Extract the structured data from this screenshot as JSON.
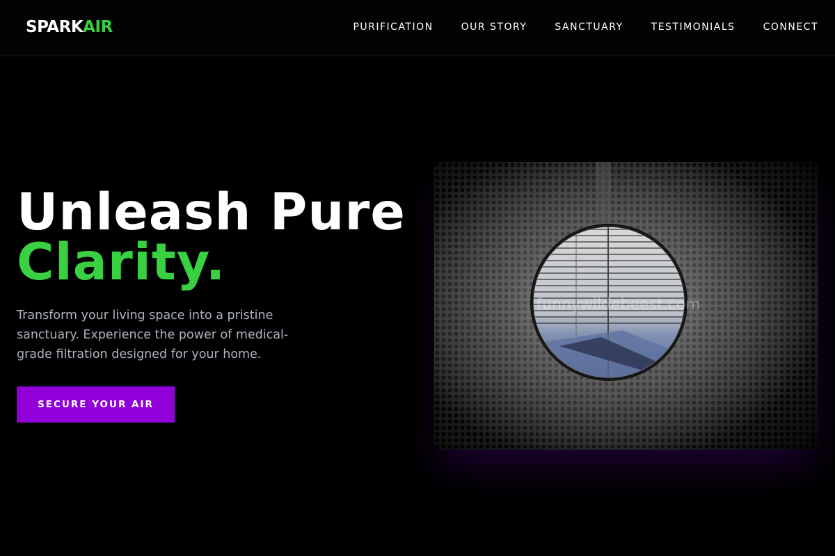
{
  "brand": {
    "part1": "SPARK",
    "part2": "AIR"
  },
  "nav": {
    "items": [
      {
        "label": "PURIFICATION"
      },
      {
        "label": "OUR STORY"
      },
      {
        "label": "SANCTUARY"
      },
      {
        "label": "TESTIMONIALS"
      },
      {
        "label": "CONNECT"
      }
    ]
  },
  "hero": {
    "title_line1": "Unleash Pure",
    "title_line2": "Clarity.",
    "subtitle": "Transform your living space into a pristine sanctuary. Experience the power of medical-grade filtration designed for your home.",
    "cta_label": "SECURE YOUR AIR",
    "image_alt": "Perforated metal air purifier tunnel viewed from inside",
    "watermark": "funnywildebeest.com"
  },
  "colors": {
    "accent_green": "#39d142",
    "accent_purple": "#9100d9",
    "background": "#000000",
    "subtitle_gray": "#aeb4c0"
  }
}
